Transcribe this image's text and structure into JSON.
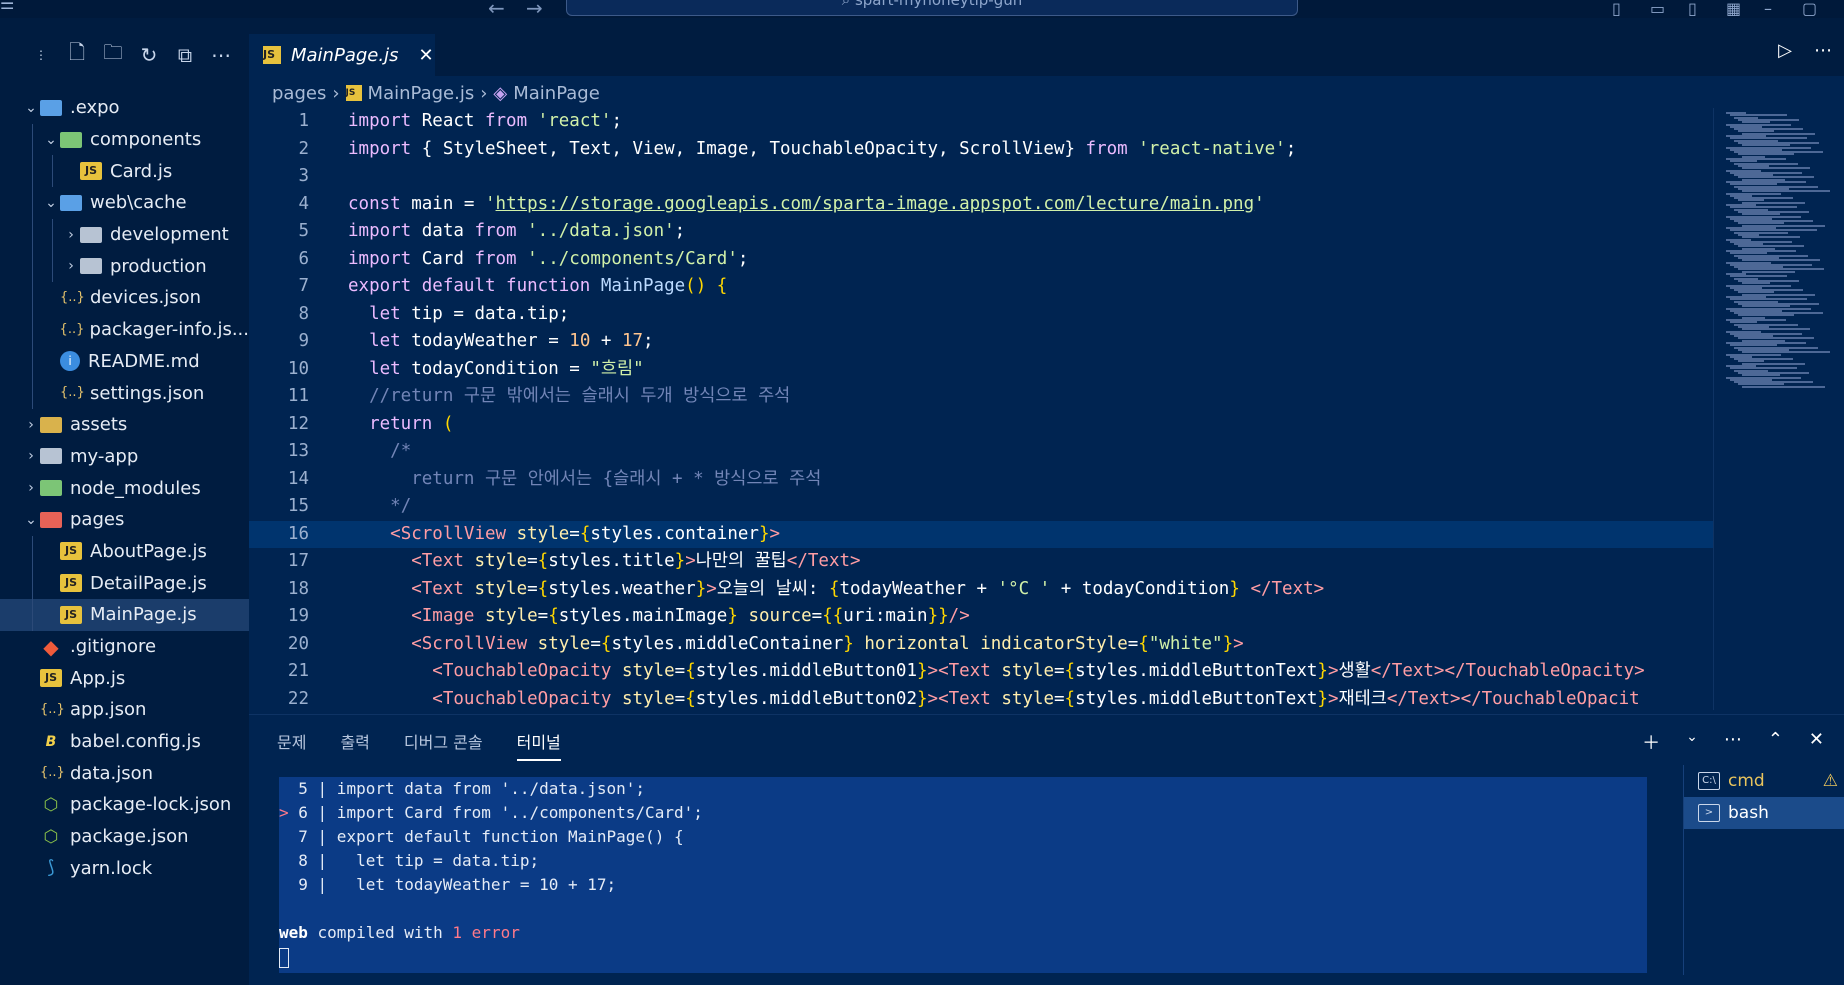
{
  "window": {
    "search_text": "spart-myhoneytip-gun"
  },
  "sidebar": {
    "items": [
      {
        "label": ".expo",
        "icon": "folder-blue",
        "depth": 0,
        "expanded": true,
        "kind": "folder"
      },
      {
        "label": "components",
        "icon": "folder-green",
        "depth": 1,
        "expanded": true,
        "kind": "folder"
      },
      {
        "label": "Card.js",
        "icon": "js",
        "depth": 2,
        "kind": "file"
      },
      {
        "label": "web\\cache",
        "icon": "folder-blue",
        "depth": 1,
        "expanded": true,
        "kind": "folder"
      },
      {
        "label": "development",
        "icon": "folder",
        "depth": 2,
        "expanded": false,
        "kind": "folder"
      },
      {
        "label": "production",
        "icon": "folder",
        "depth": 2,
        "expanded": false,
        "kind": "folder"
      },
      {
        "label": "devices.json",
        "icon": "json",
        "depth": 1,
        "kind": "file"
      },
      {
        "label": "packager-info.js...",
        "icon": "json",
        "depth": 1,
        "kind": "file"
      },
      {
        "label": "README.md",
        "icon": "info",
        "depth": 1,
        "kind": "file"
      },
      {
        "label": "settings.json",
        "icon": "json",
        "depth": 1,
        "kind": "file"
      },
      {
        "label": "assets",
        "icon": "folder-yellow",
        "depth": 0,
        "expanded": false,
        "kind": "folder"
      },
      {
        "label": "my-app",
        "icon": "folder",
        "depth": 0,
        "expanded": false,
        "kind": "folder"
      },
      {
        "label": "node_modules",
        "icon": "folder-green",
        "depth": 0,
        "expanded": false,
        "kind": "folder"
      },
      {
        "label": "pages",
        "icon": "folder-red",
        "depth": 0,
        "expanded": true,
        "kind": "folder"
      },
      {
        "label": "AboutPage.js",
        "icon": "js",
        "depth": 1,
        "kind": "file"
      },
      {
        "label": "DetailPage.js",
        "icon": "js",
        "depth": 1,
        "kind": "file"
      },
      {
        "label": "MainPage.js",
        "icon": "js",
        "depth": 1,
        "kind": "file",
        "selected": true
      },
      {
        "label": ".gitignore",
        "icon": "git",
        "depth": 0,
        "kind": "file"
      },
      {
        "label": "App.js",
        "icon": "js",
        "depth": 0,
        "kind": "file"
      },
      {
        "label": "app.json",
        "icon": "json",
        "depth": 0,
        "kind": "file"
      },
      {
        "label": "babel.config.js",
        "icon": "babel",
        "depth": 0,
        "kind": "file"
      },
      {
        "label": "data.json",
        "icon": "json",
        "depth": 0,
        "kind": "file"
      },
      {
        "label": "package-lock.json",
        "icon": "node",
        "depth": 0,
        "kind": "file"
      },
      {
        "label": "package.json",
        "icon": "node",
        "depth": 0,
        "kind": "file"
      },
      {
        "label": "yarn.lock",
        "icon": "yarn",
        "depth": 0,
        "kind": "file"
      }
    ]
  },
  "editor": {
    "tab_label": "MainPage.js",
    "breadcrumb": [
      "pages",
      "MainPage.js",
      "MainPage"
    ],
    "highlight_line": 16,
    "lines": [
      [
        [
          "kw",
          "import "
        ],
        [
          "",
          "React "
        ],
        [
          "kw",
          "from "
        ],
        [
          "str",
          "'react'"
        ],
        [
          "",
          ";"
        ]
      ],
      [
        [
          "kw",
          "import "
        ],
        [
          "",
          "{ StyleSheet, Text, View, Image, TouchableOpacity, ScrollView} "
        ],
        [
          "kw",
          "from "
        ],
        [
          "str",
          "'react-native'"
        ],
        [
          "",
          ";"
        ]
      ],
      [],
      [
        [
          "kw",
          "const "
        ],
        [
          "",
          "main = "
        ],
        [
          "str",
          "'"
        ],
        [
          "str url",
          "https://storage.googleapis.com/sparta-image.appspot.com/lecture/main.png"
        ],
        [
          "str",
          "'"
        ]
      ],
      [
        [
          "kw",
          "import "
        ],
        [
          "",
          "data "
        ],
        [
          "kw",
          "from "
        ],
        [
          "str",
          "'../data.json'"
        ],
        [
          "",
          ";"
        ]
      ],
      [
        [
          "kw",
          "import "
        ],
        [
          "",
          "Card "
        ],
        [
          "kw",
          "from "
        ],
        [
          "str",
          "'../components/Card'"
        ],
        [
          "",
          ";"
        ]
      ],
      [
        [
          "kw",
          "export default function "
        ],
        [
          "fn",
          "MainPage"
        ],
        [
          "brace",
          "() {"
        ]
      ],
      [
        [
          "",
          "  "
        ],
        [
          "kw",
          "let "
        ],
        [
          "",
          "tip = data.tip;"
        ]
      ],
      [
        [
          "",
          "  "
        ],
        [
          "kw",
          "let "
        ],
        [
          "",
          "todayWeather = "
        ],
        [
          "num",
          "10"
        ],
        [
          "",
          " + "
        ],
        [
          "num",
          "17"
        ],
        [
          "",
          ";"
        ]
      ],
      [
        [
          "",
          "  "
        ],
        [
          "kw",
          "let "
        ],
        [
          "",
          "todayCondition = "
        ],
        [
          "str",
          "\"흐림\""
        ]
      ],
      [
        [
          "",
          "  "
        ],
        [
          "cmt",
          "//return 구문 밖에서는 슬래시 두개 방식으로 주석"
        ]
      ],
      [
        [
          "",
          "  "
        ],
        [
          "kw",
          "return "
        ],
        [
          "brace",
          "("
        ]
      ],
      [
        [
          "",
          "    "
        ],
        [
          "cmt",
          "/*"
        ]
      ],
      [
        [
          "",
          "      "
        ],
        [
          "cmt",
          "return 구문 안에서는 {슬래시 + * 방식으로 주석"
        ]
      ],
      [
        [
          "",
          "    "
        ],
        [
          "cmt",
          "*/"
        ]
      ],
      [
        [
          "",
          "    "
        ],
        [
          "tag",
          "<ScrollView "
        ],
        [
          "attr",
          "style"
        ],
        [
          "",
          "="
        ],
        [
          "brace",
          "{"
        ],
        [
          "",
          "styles.container"
        ],
        [
          "brace",
          "}"
        ],
        [
          "tag",
          ">"
        ]
      ],
      [
        [
          "",
          "      "
        ],
        [
          "tag",
          "<Text "
        ],
        [
          "attr",
          "style"
        ],
        [
          "",
          "="
        ],
        [
          "brace",
          "{"
        ],
        [
          "",
          "styles.title"
        ],
        [
          "brace",
          "}"
        ],
        [
          "tag",
          ">"
        ],
        [
          "",
          "나만의 꿀팁"
        ],
        [
          "tag",
          "</Text>"
        ]
      ],
      [
        [
          "",
          "      "
        ],
        [
          "tag",
          "<Text "
        ],
        [
          "attr",
          "style"
        ],
        [
          "",
          "="
        ],
        [
          "brace",
          "{"
        ],
        [
          "",
          "styles.weather"
        ],
        [
          "brace",
          "}"
        ],
        [
          "tag",
          ">"
        ],
        [
          "",
          "오늘의 날씨: "
        ],
        [
          "brace",
          "{"
        ],
        [
          "",
          "todayWeather + "
        ],
        [
          "str",
          "'°C '"
        ],
        [
          "",
          " + todayCondition"
        ],
        [
          "brace",
          "}"
        ],
        [
          "",
          " "
        ],
        [
          "tag",
          "</Text>"
        ]
      ],
      [
        [
          "",
          "      "
        ],
        [
          "tag",
          "<Image "
        ],
        [
          "attr",
          "style"
        ],
        [
          "",
          "="
        ],
        [
          "brace",
          "{"
        ],
        [
          "",
          "styles.mainImage"
        ],
        [
          "brace",
          "}"
        ],
        [
          "",
          " "
        ],
        [
          "attr",
          "source"
        ],
        [
          "",
          "="
        ],
        [
          "brace",
          "{{"
        ],
        [
          "",
          "uri:main"
        ],
        [
          "brace",
          "}}"
        ],
        [
          "tag",
          "/>"
        ]
      ],
      [
        [
          "",
          "      "
        ],
        [
          "tag",
          "<ScrollView "
        ],
        [
          "attr",
          "style"
        ],
        [
          "",
          "="
        ],
        [
          "brace",
          "{"
        ],
        [
          "",
          "styles.middleContainer"
        ],
        [
          "brace",
          "}"
        ],
        [
          "",
          " "
        ],
        [
          "attr",
          "horizontal indicatorStyle"
        ],
        [
          "",
          "="
        ],
        [
          "brace",
          "{"
        ],
        [
          "str",
          "\"white\""
        ],
        [
          "brace",
          "}"
        ],
        [
          "tag",
          ">"
        ]
      ],
      [
        [
          "",
          "        "
        ],
        [
          "tag",
          "<TouchableOpacity "
        ],
        [
          "attr",
          "style"
        ],
        [
          "",
          "="
        ],
        [
          "brace",
          "{"
        ],
        [
          "",
          "styles.middleButton01"
        ],
        [
          "brace",
          "}"
        ],
        [
          "tag",
          "><Text "
        ],
        [
          "attr",
          "style"
        ],
        [
          "",
          "="
        ],
        [
          "brace",
          "{"
        ],
        [
          "",
          "styles.middleButtonText"
        ],
        [
          "brace",
          "}"
        ],
        [
          "tag",
          ">"
        ],
        [
          "",
          "생활"
        ],
        [
          "tag",
          "</Text></TouchableOpacity>"
        ]
      ],
      [
        [
          "",
          "        "
        ],
        [
          "tag",
          "<TouchableOpacity "
        ],
        [
          "attr",
          "style"
        ],
        [
          "",
          "="
        ],
        [
          "brace",
          "{"
        ],
        [
          "",
          "styles.middleButton02"
        ],
        [
          "brace",
          "}"
        ],
        [
          "tag",
          "><Text "
        ],
        [
          "attr",
          "style"
        ],
        [
          "",
          "="
        ],
        [
          "brace",
          "{"
        ],
        [
          "",
          "styles.middleButtonText"
        ],
        [
          "brace",
          "}"
        ],
        [
          "tag",
          ">"
        ],
        [
          "",
          "재테크"
        ],
        [
          "tag",
          "</Text></TouchableOpacit"
        ]
      ]
    ]
  },
  "panel": {
    "tabs": [
      "문제",
      "출력",
      "디버그 콘솔",
      "터미널"
    ],
    "active_tab": 3,
    "terminal_lines": [
      {
        "marker": " ",
        "text": " 5 | import data from '../data.json';"
      },
      {
        "marker": ">",
        "text": " 6 | import Card from '../components/Card';"
      },
      {
        "marker": " ",
        "text": " 7 | export default function MainPage() {"
      },
      {
        "marker": " ",
        "text": " 8 |   let tip = data.tip;"
      },
      {
        "marker": " ",
        "text": " 9 |   let todayWeather = 10 + 17;"
      }
    ],
    "status_web": "web",
    "status_mid": " compiled with ",
    "status_err": "1 error",
    "terminals": [
      {
        "label": "cmd",
        "icon": "cmd-icon",
        "warning": true
      },
      {
        "label": "bash",
        "icon": "bash-icon",
        "active": true
      }
    ]
  }
}
